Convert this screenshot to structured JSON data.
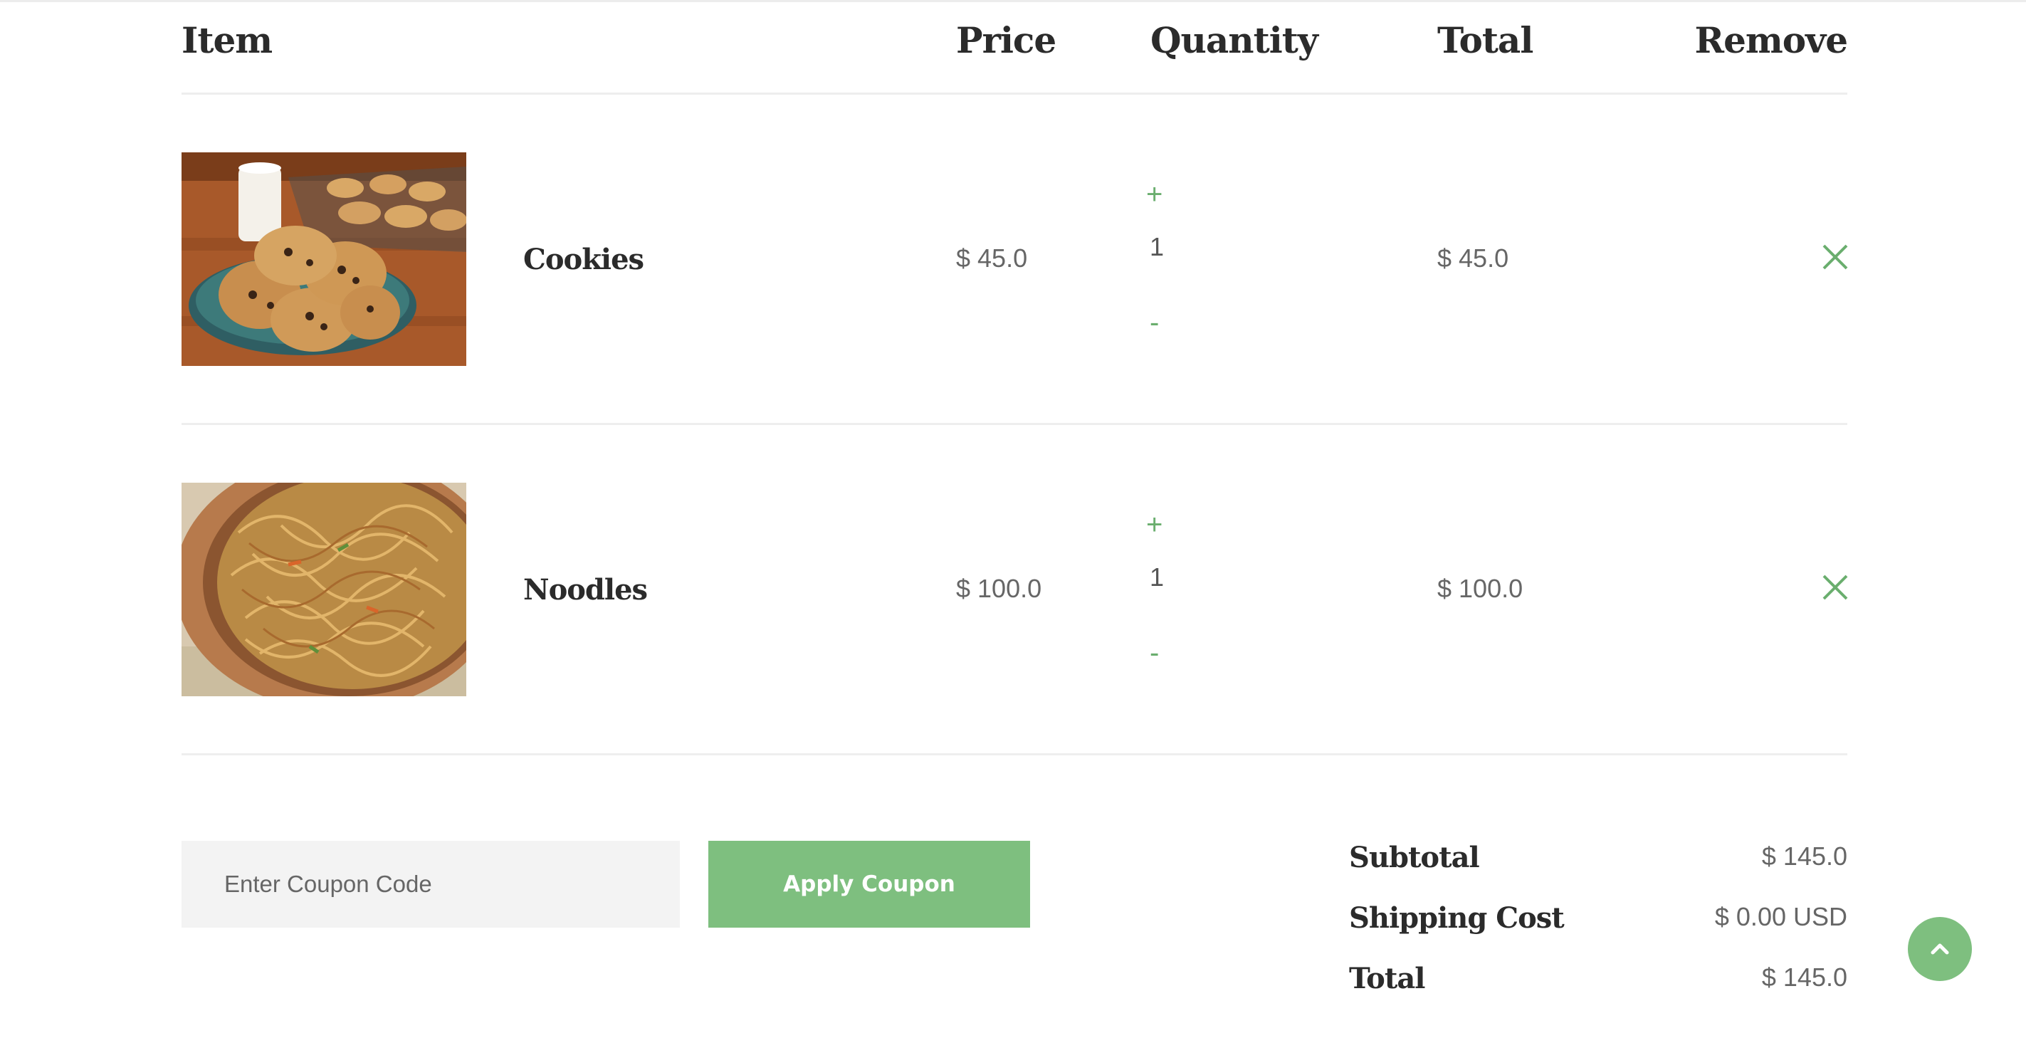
{
  "table": {
    "headers": {
      "item": "Item",
      "price": "Price",
      "quantity": "Quantity",
      "total": "Total",
      "remove": "Remove"
    },
    "rows": [
      {
        "name": "Cookies",
        "price": "$ 45.0",
        "qty_plus": "+",
        "quantity": "1",
        "qty_minus": "-",
        "total": "$ 45.0",
        "image_icon": "cookies-photo",
        "remove_icon": "close-icon"
      },
      {
        "name": "Noodles",
        "price": "$ 100.0",
        "qty_plus": "+",
        "quantity": "1",
        "qty_minus": "-",
        "total": "$ 100.0",
        "image_icon": "noodles-photo",
        "remove_icon": "close-icon"
      }
    ]
  },
  "coupon": {
    "placeholder": "Enter Coupon Code",
    "apply_label": "Apply Coupon"
  },
  "summary": {
    "subtotal_label": "Subtotal",
    "subtotal_value": "$ 145.0",
    "shipping_label": "Shipping Cost",
    "shipping_value": "$ 0.00 USD",
    "total_label": "Total",
    "total_value": "$ 145.0"
  },
  "scroll_top_icon": "chevron-up-icon",
  "colors": {
    "accent": "#7ebf7f",
    "accent_text": "#6aae6e",
    "heading": "#2b2b2b",
    "muted": "#666666",
    "input_bg": "#f3f3f3",
    "divider": "#eeeeee"
  }
}
